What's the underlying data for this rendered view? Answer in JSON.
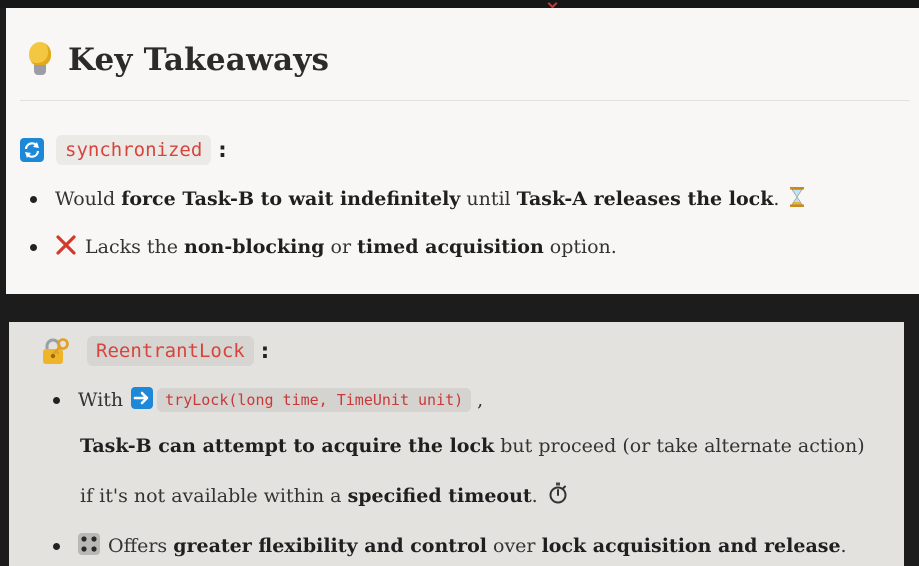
{
  "title": "Key Takeaways",
  "sync": {
    "label": "synchronized",
    "colon": ":",
    "bullet1": {
      "p1": "Would ",
      "b1": "force Task-B to wait indefinitely",
      "p2": " until ",
      "b2": "Task-A releases the lock",
      "p3": "."
    },
    "bullet2": {
      "p1": "Lacks the ",
      "b1": "non-blocking",
      "p2": " or ",
      "b2": "timed acquisition",
      "p3": " option."
    }
  },
  "reentrant": {
    "label": "ReentrantLock",
    "colon": ":",
    "bullet1": {
      "p1": "With",
      "code": "tryLock(long time, TimeUnit unit)",
      "p2": ","
    },
    "line2": {
      "b1": "Task-B can attempt to acquire the lock",
      "p1": " but proceed (or take alternate action)"
    },
    "line3": {
      "p1": "if it's not available within a ",
      "b1": "specified timeout",
      "p2": "."
    },
    "bullet2": {
      "p1": "Offers ",
      "b1": "greater flexibility and control",
      "p2": " over ",
      "b2": "lock acquisition and release",
      "p3": "."
    }
  },
  "icons": {
    "title": "lightbulb-icon",
    "sync": "refresh-icon",
    "hourglass": "hourglass-icon",
    "cross": "cross-mark-icon",
    "reentrant": "locked-with-key-icon",
    "arrow": "right-arrow-icon",
    "stopwatch": "stopwatch-icon",
    "dice": "dice-icon"
  },
  "colors": {
    "code_text": "#d7443d",
    "code_bg": "#ebeae6",
    "refresh_icon": "#1e88d8",
    "cross_mark": "#d23a2e",
    "arrow_icon": "#1e88d8"
  }
}
